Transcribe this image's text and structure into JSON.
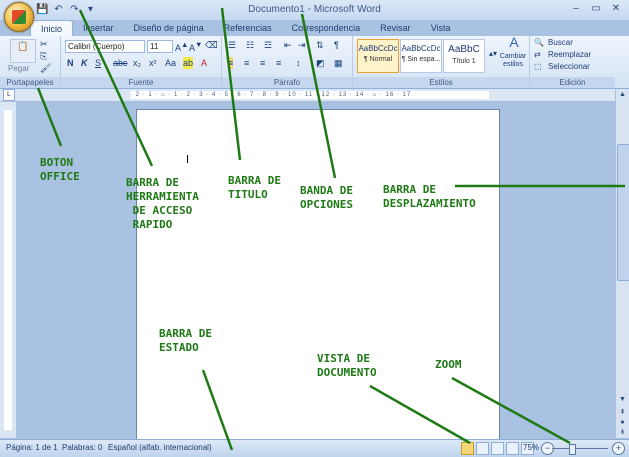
{
  "window": {
    "title": "Documento1 - Microsoft Word",
    "controls": [
      "–",
      "▭",
      "✕"
    ]
  },
  "ribbon_tabs": [
    "Inicio",
    "Insertar",
    "Diseño de página",
    "Referencias",
    "Correspondencia",
    "Revisar",
    "Vista"
  ],
  "ribbon": {
    "paste_label": "Pegar",
    "font_name": "Calibri (Cuerpo)",
    "font_size": "11",
    "styles": [
      {
        "preview": "AaBbCcDc",
        "name": "¶ Normal"
      },
      {
        "preview": "AaBbCcDc",
        "name": "¶ Sin espa..."
      },
      {
        "preview": "AaBbC",
        "name": "Título 1"
      }
    ],
    "change_styles_label": "Cambiar estilos",
    "editing": [
      "Buscar",
      "Reemplazar",
      "Seleccionar"
    ],
    "group_labels": {
      "clipboard": "Portapapeles",
      "font": "Fuente",
      "paragraph": "Párrafo",
      "styles": "Estilos",
      "editing": "Edición"
    }
  },
  "ruler_text": "· 2 · 1 · ⌂ · 1 · 2 · 3 · 4 · 5 · 6 · 7 · 8 · 9 · 10 · 11 · 12 · 13 · 14 · ⌂ · 16 · 17",
  "status_bar": {
    "page": "Página: 1 de 1",
    "words": "Palabras: 0",
    "language": "Español (alfab. internacional)",
    "zoom": "75%"
  },
  "annotations": {
    "boton_office": "BOTON\nOFFICE",
    "barra_herramienta": "BARRA DE\nHERRAMIENTA\n DE ACCESO\n RAPIDO",
    "barra_titulo": "BARRA DE\nTITULO",
    "banda_opciones": "BANDA DE\nOPCIONES",
    "barra_desplazamiento": "BARRA DE\nDESPLAZAMIENTO",
    "barra_estado": "BARRA DE\nESTADO",
    "vista_documento": "VISTA DE\nDOCUMENTO",
    "zoom": "ZOOM"
  },
  "colors": {
    "annotation": "#1f7a15",
    "ribbon_bg": "#d4e3f5",
    "workspace": "#a9c2e2"
  }
}
